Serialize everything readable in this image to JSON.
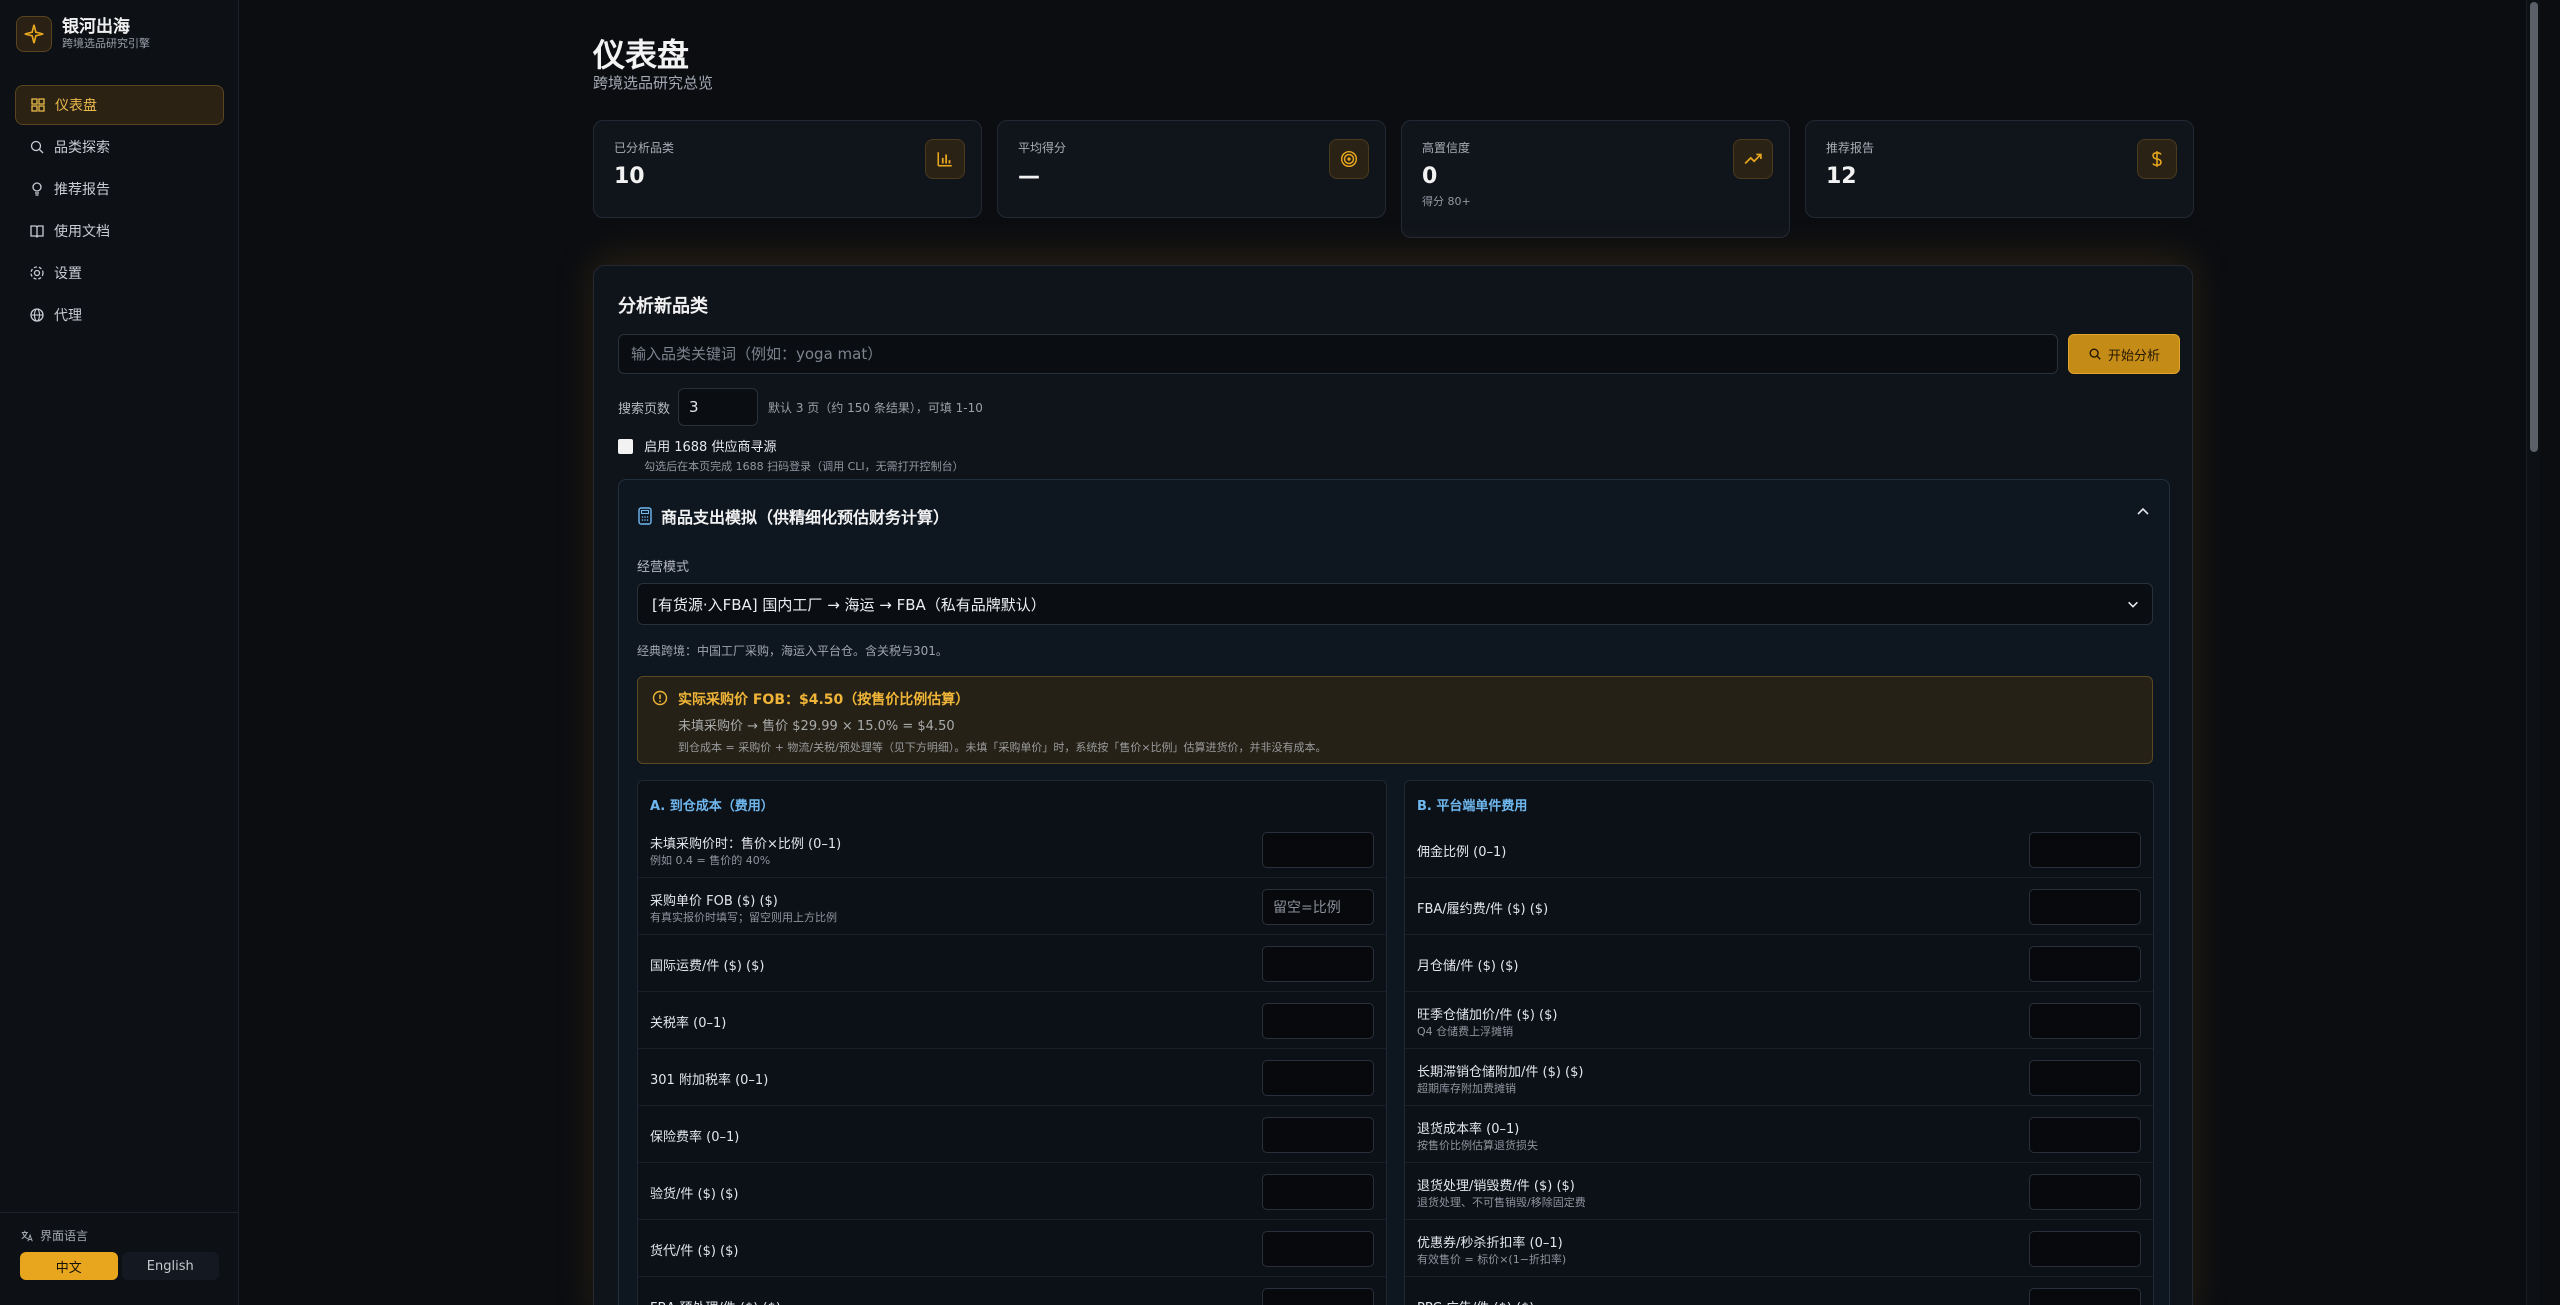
{
  "brand": {
    "name": "银河出海",
    "subtitle": "跨境选品研究引擎"
  },
  "sidebar": {
    "items": [
      {
        "label": "仪表盘",
        "icon": "dashboard-icon",
        "active": true
      },
      {
        "label": "品类探索",
        "icon": "search-icon"
      },
      {
        "label": "推荐报告",
        "icon": "lightbulb-icon"
      },
      {
        "label": "使用文档",
        "icon": "book-icon"
      },
      {
        "label": "设置",
        "icon": "gear-icon"
      },
      {
        "label": "代理",
        "icon": "globe-icon"
      }
    ],
    "language": {
      "label": "界面语言",
      "options": [
        "中文",
        "English"
      ],
      "selected": "中文"
    }
  },
  "page": {
    "title": "仪表盘",
    "subtitle": "跨境选品研究总览"
  },
  "stats": [
    {
      "label": "已分析品类",
      "value": "10",
      "note": "",
      "icon": "bar-chart-icon"
    },
    {
      "label": "平均得分",
      "value": "—",
      "note": "",
      "icon": "target-icon"
    },
    {
      "label": "高置信度",
      "value": "0",
      "note": "得分 80+",
      "icon": "trending-up-icon"
    },
    {
      "label": "推荐报告",
      "value": "12",
      "note": "",
      "icon": "dollar-icon"
    }
  ],
  "analyze": {
    "title": "分析新品类",
    "keyword_placeholder": "输入品类关键词（例如：yoga mat）",
    "button_label": "开始分析",
    "pages_label": "搜索页数",
    "pages_value": "3",
    "pages_hint": "默认 3 页（约 150 条结果），可填 1-10",
    "supplier_title": "启用 1688 供应商寻源",
    "supplier_sub": "勾选后在本页完成 1688 扫码登录（调用 CLI，无需打开控制台）"
  },
  "cost_sim": {
    "title": "商品支出模拟（供精细化预估财务计算）",
    "mode_label": "经营模式",
    "mode_value": "[有货源·入FBA] 国内工厂 → 海运 → FBA（私有品牌默认）",
    "mode_desc": "经典跨境：中国工厂采购，海运入平台仓。含关税与301。",
    "warning": {
      "title": "实际采购价 FOB：$4.50（按售价比例估算）",
      "line": "未填采购价 → 售价 $29.99 × 15.0% = $4.50",
      "note": "到仓成本 = 采购价 + 物流/关税/预处理等（见下方明细）。未填「采购单价」时，系统按「售价×比例」估算进货价，并非没有成本。"
    },
    "col_a": {
      "title": "A. 到仓成本（费用）",
      "fields": [
        {
          "label": "未填采购价时：售价×比例 (0–1)",
          "sub": "例如 0.4 = 售价的 40%",
          "value": ""
        },
        {
          "label": "采购单价 FOB ($) ($)",
          "sub": "有真实报价时填写；留空则用上方比例",
          "value": "留空=比例"
        },
        {
          "label": "国际运费/件 ($) ($)",
          "sub": "",
          "value": ""
        },
        {
          "label": "关税率 (0–1)",
          "sub": "",
          "value": ""
        },
        {
          "label": "301 附加税率 (0–1)",
          "sub": "",
          "value": ""
        },
        {
          "label": "保险费率 (0–1)",
          "sub": "",
          "value": ""
        },
        {
          "label": "验货/件 ($) ($)",
          "sub": "",
          "value": ""
        },
        {
          "label": "货代/件 ($) ($)",
          "sub": "",
          "value": ""
        },
        {
          "label": "FBA 预处理/件 ($) ($)",
          "sub": "",
          "value": ""
        }
      ]
    },
    "col_b": {
      "title": "B. 平台端单件费用",
      "fields": [
        {
          "label": "佣金比例 (0–1)",
          "sub": "",
          "value": ""
        },
        {
          "label": "FBA/履约费/件 ($) ($)",
          "sub": "",
          "value": ""
        },
        {
          "label": "月仓储/件 ($) ($)",
          "sub": "",
          "value": ""
        },
        {
          "label": "旺季仓储加价/件 ($) ($)",
          "sub": "Q4 仓储费上浮摊销",
          "value": ""
        },
        {
          "label": "长期滞销仓储附加/件 ($) ($)",
          "sub": "超期库存附加费摊销",
          "value": ""
        },
        {
          "label": "退货成本率 (0–1)",
          "sub": "按售价比例估算退货损失",
          "value": ""
        },
        {
          "label": "退货处理/销毁费/件 ($) ($)",
          "sub": "退货处理、不可售销毁/移除固定费",
          "value": ""
        },
        {
          "label": "优惠券/秒杀折扣率 (0–1)",
          "sub": "有效售价 = 标价×(1−折扣率)",
          "value": ""
        },
        {
          "label": "PPC 广告/件 ($) ($)",
          "sub": "",
          "value": ""
        }
      ]
    }
  },
  "colors": {
    "accent": "#e7a61e",
    "background": "#0b0d11",
    "info": "#6fb8ef"
  }
}
